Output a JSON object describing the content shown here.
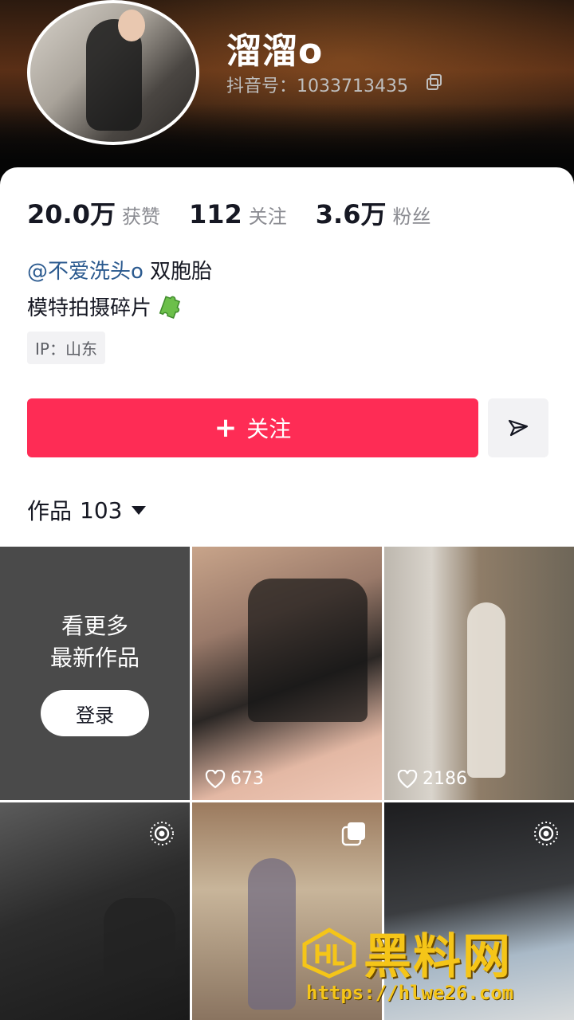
{
  "profile": {
    "name": "溜溜o",
    "douyin_id": "抖音号：1033713435"
  },
  "stats": [
    {
      "value": "20.0万",
      "label": "获赞"
    },
    {
      "value": "112",
      "label": "关注"
    },
    {
      "value": "3.6万",
      "label": "粉丝"
    }
  ],
  "bio": {
    "mention": "@不爱洗头o",
    "mention_suffix": " 双胞胎",
    "line2": "模特拍摄碎片",
    "ip": "IP：山东"
  },
  "actions": {
    "follow_label": "关注",
    "follow_plus": "+"
  },
  "works": {
    "label": "作品",
    "count": "103"
  },
  "grid": {
    "more_line1": "看更多",
    "more_line2": "最新作品",
    "login_label": "登录",
    "items": [
      {
        "likes": "673"
      },
      {
        "likes": "2186"
      }
    ]
  },
  "watermark": {
    "text": "黑料网",
    "url": "https://hlwe26.com"
  },
  "colors": {
    "accent": "#fe2c55",
    "mention": "#2b5a8f",
    "watermark": "#f5c518"
  }
}
